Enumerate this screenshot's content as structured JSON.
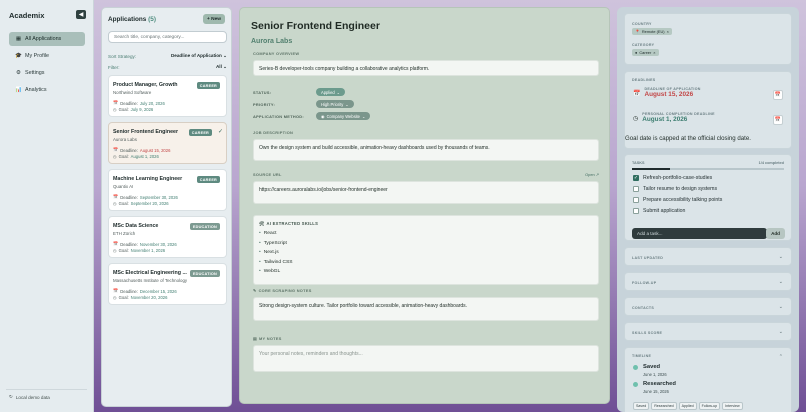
{
  "sidebar": {
    "brand": "Academix",
    "collapse_icon": "◀",
    "items": [
      {
        "icon": "▦",
        "label": "All Applications",
        "active": true
      },
      {
        "icon": "🎓",
        "label": "My Profile"
      },
      {
        "icon": "⚙",
        "label": "Settings"
      },
      {
        "icon": "📊",
        "label": "Analytics"
      }
    ],
    "footer_icon": "↻",
    "footer": "Local demo data"
  },
  "apps": {
    "title": "Applications",
    "count": "(5)",
    "new_label": "+ New",
    "search_placeholder": "Search title, company, category...",
    "sort_label": "Sort Strategy:",
    "sort_value": "Deadline of Application",
    "filter_label": "Filter:",
    "filter_value": "All",
    "chevron": "⌄",
    "cards": [
      {
        "title": "Product Manager, Growth",
        "company": "Northwind Software",
        "badge": "CAREER",
        "deadline_label": "Deadline:",
        "deadline": "July 20, 2026",
        "goal_label": "Goal:",
        "goal": "July 9, 2026"
      },
      {
        "title": "Senior Frontend Engineer",
        "company": "Aurora Labs",
        "badge": "CAREER",
        "deadline_label": "Deadline:",
        "deadline": "August 15, 2026",
        "goal_label": "Goal:",
        "goal": "August 1, 2026",
        "selected": true
      },
      {
        "title": "Machine Learning Engineer",
        "company": "Quantix AI",
        "badge": "CAREER",
        "deadline_label": "Deadline:",
        "deadline": "September 30, 2026",
        "goal_label": "Goal:",
        "goal": "September 20, 2026"
      },
      {
        "title": "MSc Data Science",
        "company": "ETH Zürich",
        "badge": "EDUCATION",
        "deadline_label": "Deadline:",
        "deadline": "November 30, 2026",
        "goal_label": "Goal:",
        "goal": "November 1, 2026"
      },
      {
        "title": "MSc Electrical Engineering ...",
        "company": "Massachusetts Institute of Technology",
        "badge": "EDUCATION",
        "deadline_label": "Deadline:",
        "deadline": "December 15, 2026",
        "goal_label": "Goal:",
        "goal": "November 20, 2026"
      }
    ]
  },
  "detail": {
    "title": "Senior Frontend Engineer",
    "company": "Aurora Labs",
    "overview_label": "COMPANY OVERVIEW",
    "overview": "Series-B developer-tools company building a collaborative analytics platform.",
    "status_label": "STATUS:",
    "status": "Applied",
    "priority_label": "PRIORITY:",
    "priority": "High Priority",
    "method_label": "APPLICATION METHOD:",
    "method": "Company Website",
    "job_label": "JOB DESCRIPTION",
    "job": "Own the design system and build accessible, animation-heavy dashboards used by thousands of teams.",
    "source_label": "SOURCE URL",
    "open_label": "Open ↗",
    "source": "https://careers.auroralabs.io/jobs/senior-frontend-engineer",
    "skills_label": "AI EXTRACTED SKILLS",
    "skills": [
      "React",
      "TypeScript",
      "Next.js",
      "Tailwind CSS",
      "WebGL"
    ],
    "notes_label": "CORE SCRAPING NOTES",
    "notes": "Strong design-system culture. Tailor portfolio toward accessible, animation-heavy dashboards.",
    "my_notes_label": "MY NOTES",
    "my_notes_placeholder": "Your personal notes, reminders and thoughts..."
  },
  "right": {
    "country_label": "COUNTRY",
    "country": "Remote (EU)",
    "category_label": "CATEGORY",
    "category": "Career",
    "deadlines_label": "DEADLINES",
    "deadline_sub": "DEADLINE OF APPLICATION",
    "deadline": "August 15, 2026",
    "goal_sub": "PERSONAL COMPLETION DEADLINE",
    "goal": "August 1, 2026",
    "goal_note": "Goal date is capped at the official closing date.",
    "tasks_label": "TASKS",
    "tasks_count": "1/4 completed",
    "tasks_progress": 0.25,
    "tasks": [
      {
        "label": "Refresh-portfolio-case-studies",
        "done": true
      },
      {
        "label": "Tailor resume to design systems",
        "done": false
      },
      {
        "label": "Prepare accessibility talking points",
        "done": false
      },
      {
        "label": "Submit application",
        "done": false
      }
    ],
    "task_placeholder": "Add a task...",
    "add_label": "Add",
    "collapsed": [
      "LAST UPDATED",
      "FOLLOW-UP",
      "CONTACTS",
      "SKILLS SCORE"
    ],
    "timeline_label": "TIMELINE",
    "timeline": [
      {
        "name": "Saved",
        "date": "June 1, 2026"
      },
      {
        "name": "Researched",
        "date": "June 15, 2026"
      }
    ],
    "timeline_tags": [
      "Saved",
      "Researched",
      "Applied",
      "Follow-up",
      "Interview"
    ]
  }
}
